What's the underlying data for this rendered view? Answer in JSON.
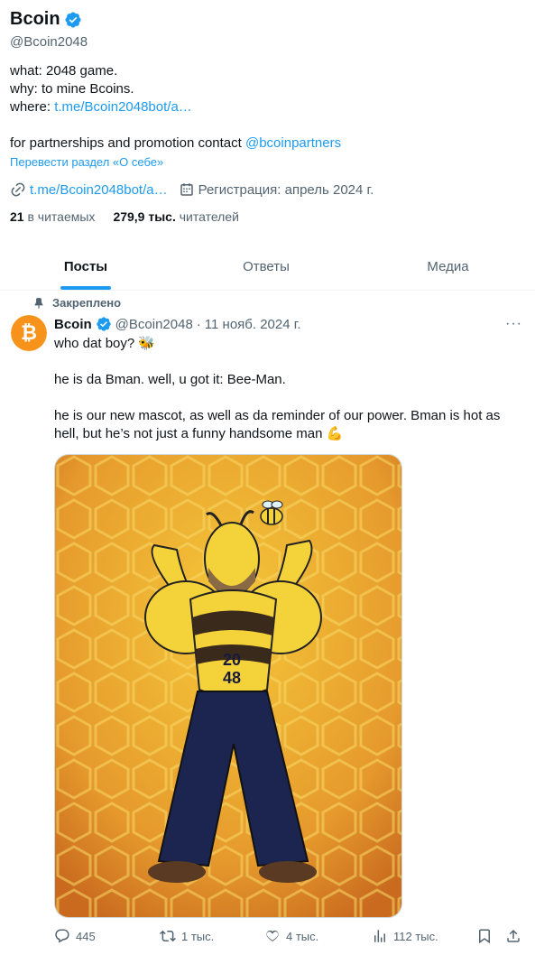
{
  "profile": {
    "name": "Bcoin",
    "handle": "@Bcoin2048",
    "bio_line1": "what: 2048 game.",
    "bio_line2": "why: to mine Bcoins.",
    "bio_line3_prefix": "where: ",
    "bio_line3_link": "t.me/Bcoin2048bot/a…",
    "bio_line4_prefix": "for partnerships and promotion contact ",
    "bio_line4_mention": "@bcoinpartners",
    "translate": "Перевести раздел «О себе»",
    "meta_link": "t.me/Bcoin2048bot/a…",
    "meta_joined": "Регистрация: апрель 2024 г.",
    "following_count": "21",
    "following_label": "в читаемых",
    "followers_count": "279,9 тыс.",
    "followers_label": "читателей"
  },
  "tabs": [
    "Посты",
    "Ответы",
    "Медиа"
  ],
  "pinned_label": "Закреплено",
  "tweet": {
    "name": "Bcoin",
    "handle": "@Bcoin2048",
    "dot": "·",
    "date": "11 нояб. 2024 г.",
    "more": "···",
    "line1": "who dat boy? 🐝",
    "line2": "he is da Bman. well, u got it: Bee-Man.",
    "line3": "he is our new mascot, as well as da reminder of our power. Bman is hot as hell, but he’s not just a funny handsome man 💪",
    "media_number_top": "20",
    "media_number_bottom": "48",
    "replies": "445",
    "reposts": "1 тыс.",
    "likes": "4 тыс.",
    "views": "112 тыс."
  },
  "colors": {
    "accent": "#1d9bf0",
    "text": "#0f1419",
    "muted": "#536471",
    "coin": "#f7931a"
  }
}
